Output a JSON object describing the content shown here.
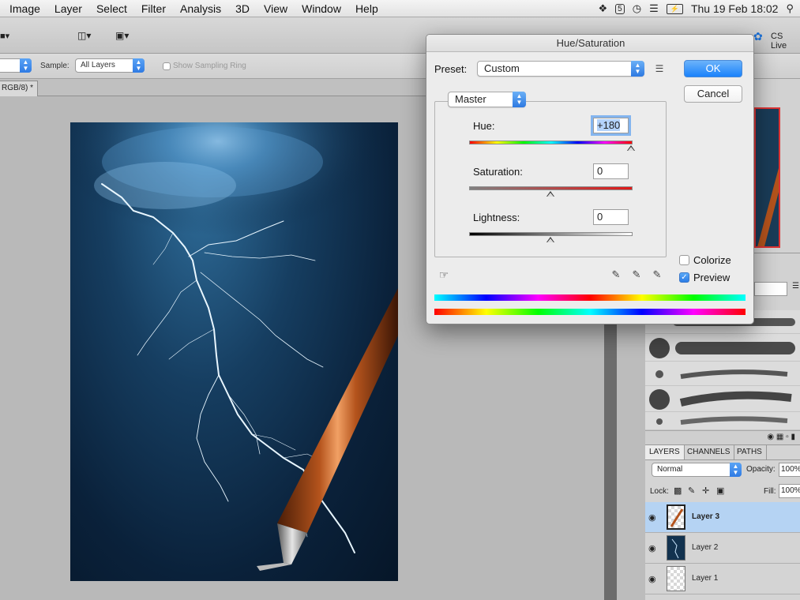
{
  "menubar": {
    "items": [
      "Image",
      "Layer",
      "Select",
      "Filter",
      "Analysis",
      "3D",
      "View",
      "Window",
      "Help"
    ],
    "clock": "Thu 19 Feb  18:02",
    "status_icons": [
      "dropbox-icon",
      "adobe-5-icon",
      "time-machine-icon",
      "wifi-icon",
      "battery-icon",
      "search-icon"
    ]
  },
  "appbar": {
    "cs_live": "CS Live"
  },
  "options_bar": {
    "sample_label": "Sample:",
    "sample_value": "All Layers",
    "show_sampling_ring": "Show Sampling Ring"
  },
  "document": {
    "tab_title": "RGB/8) *"
  },
  "dialog": {
    "title": "Hue/Saturation",
    "preset_label": "Preset:",
    "preset_value": "Custom",
    "ok_label": "OK",
    "cancel_label": "Cancel",
    "channel_value": "Master",
    "hue_label": "Hue:",
    "hue_value": "+180",
    "saturation_label": "Saturation:",
    "saturation_value": "0",
    "lightness_label": "Lightness:",
    "lightness_value": "0",
    "hue_slider_fraction": 1.0,
    "saturation_slider_fraction": 0.5,
    "lightness_slider_fraction": 0.5,
    "colorize_label": "Colorize",
    "colorize_checked": false,
    "preview_label": "Preview",
    "preview_checked": true
  },
  "layers_panel": {
    "tabs": [
      "LAYERS",
      "CHANNELS",
      "PATHS"
    ],
    "blend_mode": "Normal",
    "opacity_label": "Opacity:",
    "opacity_value": "100%",
    "lock_label": "Lock:",
    "fill_label": "Fill:",
    "fill_value": "100%",
    "layers": [
      {
        "name": "Layer 3",
        "selected": true
      },
      {
        "name": "Layer 2",
        "selected": false
      },
      {
        "name": "Layer 1",
        "selected": false
      }
    ]
  }
}
